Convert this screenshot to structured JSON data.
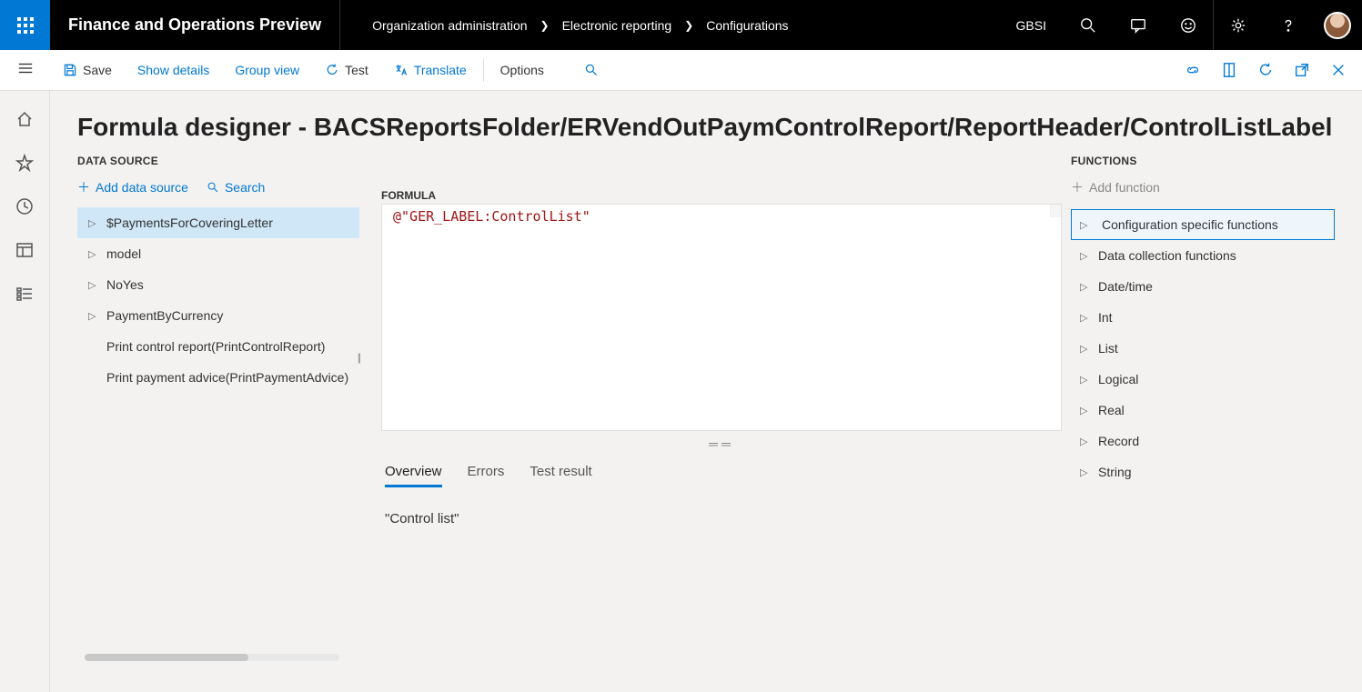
{
  "header": {
    "app_title": "Finance and Operations Preview",
    "breadcrumbs": [
      "Organization administration",
      "Electronic reporting",
      "Configurations"
    ],
    "company": "GBSI"
  },
  "actionbar": {
    "save": "Save",
    "show_details": "Show details",
    "group_view": "Group view",
    "test": "Test",
    "translate": "Translate",
    "options": "Options"
  },
  "page": {
    "title": "Formula designer - BACSReportsFolder/ERVendOutPaymControlReport/ReportHeader/ControlListLabel"
  },
  "datasource": {
    "heading": "DATA SOURCE",
    "add_label": "Add data source",
    "search_label": "Search",
    "items": [
      {
        "label": "$PaymentsForCoveringLetter",
        "expandable": true,
        "selected": true
      },
      {
        "label": "model",
        "expandable": true,
        "selected": false
      },
      {
        "label": "NoYes",
        "expandable": true,
        "selected": false
      },
      {
        "label": "PaymentByCurrency",
        "expandable": true,
        "selected": false
      },
      {
        "label": "Print control report(PrintControlReport)",
        "expandable": false,
        "selected": false
      },
      {
        "label": "Print payment advice(PrintPaymentAdvice)",
        "expandable": false,
        "selected": false
      }
    ]
  },
  "formula": {
    "heading": "FORMULA",
    "text": "@\"GER_LABEL:ControlList\""
  },
  "tabs": {
    "items": [
      "Overview",
      "Errors",
      "Test result"
    ],
    "active_index": 0,
    "overview_text": "\"Control list\""
  },
  "functions": {
    "heading": "FUNCTIONS",
    "add_label": "Add function",
    "items": [
      {
        "label": "Configuration specific functions",
        "selected": true
      },
      {
        "label": "Data collection functions",
        "selected": false
      },
      {
        "label": "Date/time",
        "selected": false
      },
      {
        "label": "Int",
        "selected": false
      },
      {
        "label": "List",
        "selected": false
      },
      {
        "label": "Logical",
        "selected": false
      },
      {
        "label": "Real",
        "selected": false
      },
      {
        "label": "Record",
        "selected": false
      },
      {
        "label": "String",
        "selected": false
      }
    ]
  }
}
